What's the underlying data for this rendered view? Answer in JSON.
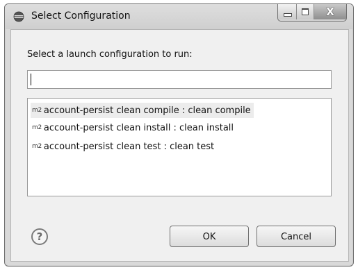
{
  "window": {
    "title": "Select Configuration",
    "app_icon": "eclipse-icon",
    "close_glyph": "X"
  },
  "dialog": {
    "prompt": "Select a launch configuration to run:",
    "filter": {
      "value": "",
      "placeholder": ""
    },
    "item_icon": "m2",
    "items": [
      {
        "label": "account-persist clean compile : clean compile",
        "selected": true
      },
      {
        "label": "account-persist clean install : clean install",
        "selected": false
      },
      {
        "label": "account-persist clean test : clean test",
        "selected": false
      }
    ],
    "help_glyph": "?",
    "ok_label": "OK",
    "cancel_label": "Cancel"
  }
}
